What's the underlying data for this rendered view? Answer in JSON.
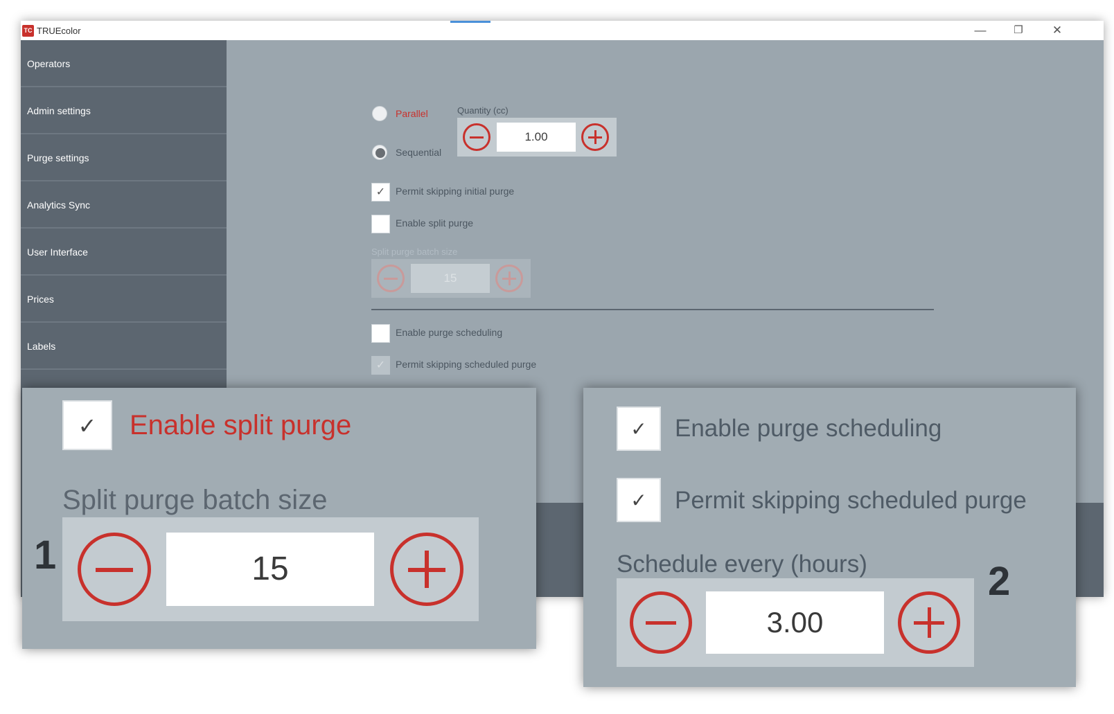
{
  "window": {
    "app_title": "TRUEcolor",
    "app_icon_text": "TC",
    "minimize_glyph": "—",
    "restore_glyph": "❐",
    "close_glyph": "✕"
  },
  "sidebar": {
    "items": [
      {
        "label": "Operators"
      },
      {
        "label": "Admin settings"
      },
      {
        "label": "Purge settings"
      },
      {
        "label": "Analytics Sync"
      },
      {
        "label": "User Interface"
      },
      {
        "label": "Prices"
      },
      {
        "label": "Labels"
      }
    ]
  },
  "purge_form": {
    "mode_options": [
      {
        "label": "Parallel",
        "selected": false
      },
      {
        "label": "Sequential",
        "selected": true
      }
    ],
    "quantity": {
      "label": "Quantity (cc)",
      "value": "1.00"
    },
    "permit_skipping_initial_purge": {
      "label": "Permit skipping initial purge",
      "checked": true
    },
    "enable_split_purge": {
      "label": "Enable split purge",
      "checked": false
    },
    "split_purge_batch_size": {
      "label": "Split purge batch size",
      "value": "15",
      "enabled": false
    },
    "enable_purge_scheduling": {
      "label": "Enable purge scheduling",
      "checked": false
    },
    "permit_skipping_scheduled_purge": {
      "label": "Permit skipping scheduled purge",
      "checked": true,
      "enabled": false
    }
  },
  "zoom_panel_1": {
    "callout": "1",
    "enable_split_purge": {
      "label": "Enable split purge",
      "checked": true
    },
    "batch_size": {
      "label": "Split purge batch size",
      "value": "15"
    }
  },
  "zoom_panel_2": {
    "callout": "2",
    "enable_purge_scheduling": {
      "label": "Enable purge scheduling",
      "checked": true
    },
    "permit_skipping_scheduled_purge": {
      "label": "Permit skipping scheduled purge",
      "checked": true
    },
    "schedule_every": {
      "label": "Schedule every (hours)",
      "value": "3.00"
    }
  },
  "icons": {
    "check_glyph": "✓"
  },
  "colors": {
    "accent_red": "#c8312c",
    "sidebar_bg": "#5c6670",
    "content_bg": "#9ba6ae"
  }
}
